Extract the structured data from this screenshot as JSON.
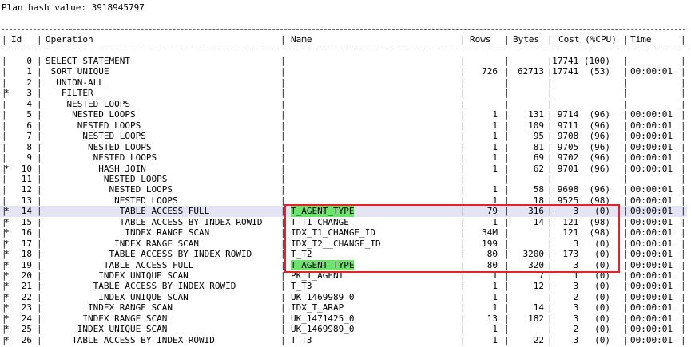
{
  "plan_hash": "Plan hash value: 3918945797",
  "columns": {
    "id": "Id",
    "operation": "Operation",
    "name": "Name",
    "rows": "Rows",
    "bytes": "Bytes",
    "cost": "Cost (%CPU)",
    "time": "Time"
  },
  "plan": [
    {
      "star": "",
      "id": "0",
      "op": "SELECT STATEMENT",
      "name": "",
      "rows": "",
      "bytes": "",
      "cost": "17741 (100)",
      "time": ""
    },
    {
      "star": "",
      "id": "1",
      "op": " SORT UNIQUE",
      "name": "",
      "rows": "726",
      "bytes": "62713",
      "cost": "17741  (53)",
      "time": "00:00:01"
    },
    {
      "star": "",
      "id": "2",
      "op": "  UNION-ALL",
      "name": "",
      "rows": "",
      "bytes": "",
      "cost": "",
      "time": ""
    },
    {
      "star": "*",
      "id": "3",
      "op": "   FILTER",
      "name": "",
      "rows": "",
      "bytes": "",
      "cost": "",
      "time": ""
    },
    {
      "star": "",
      "id": "4",
      "op": "    NESTED LOOPS",
      "name": "",
      "rows": "",
      "bytes": "",
      "cost": "",
      "time": ""
    },
    {
      "star": "",
      "id": "5",
      "op": "     NESTED LOOPS",
      "name": "",
      "rows": "1",
      "bytes": "131",
      "cost": "9714  (96)",
      "time": "00:00:01"
    },
    {
      "star": "",
      "id": "6",
      "op": "      NESTED LOOPS",
      "name": "",
      "rows": "1",
      "bytes": "109",
      "cost": "9711  (96)",
      "time": "00:00:01"
    },
    {
      "star": "",
      "id": "7",
      "op": "       NESTED LOOPS",
      "name": "",
      "rows": "1",
      "bytes": "95",
      "cost": "9708  (96)",
      "time": "00:00:01"
    },
    {
      "star": "",
      "id": "8",
      "op": "        NESTED LOOPS",
      "name": "",
      "rows": "1",
      "bytes": "81",
      "cost": "9705  (96)",
      "time": "00:00:01"
    },
    {
      "star": "",
      "id": "9",
      "op": "         NESTED LOOPS",
      "name": "",
      "rows": "1",
      "bytes": "69",
      "cost": "9702  (96)",
      "time": "00:00:01"
    },
    {
      "star": "*",
      "id": "10",
      "op": "          HASH JOIN",
      "name": "",
      "rows": "1",
      "bytes": "62",
      "cost": "9701  (96)",
      "time": "00:00:01"
    },
    {
      "star": "",
      "id": "11",
      "op": "           NESTED LOOPS",
      "name": "",
      "rows": "",
      "bytes": "",
      "cost": "",
      "time": ""
    },
    {
      "star": "",
      "id": "12",
      "op": "            NESTED LOOPS",
      "name": "",
      "rows": "1",
      "bytes": "58",
      "cost": "9698  (96)",
      "time": "00:00:01"
    },
    {
      "star": "",
      "id": "13",
      "op": "             NESTED LOOPS",
      "name": "",
      "rows": "1",
      "bytes": "18",
      "cost": "9525  (98)",
      "time": "00:00:01"
    },
    {
      "star": "*",
      "id": "14",
      "op": "              TABLE ACCESS FULL",
      "name": "T_AGENT_TYPE",
      "rows": "79",
      "bytes": "316",
      "cost": "3   (0)",
      "time": "00:00:01"
    },
    {
      "star": "*",
      "id": "15",
      "op": "              TABLE ACCESS BY INDEX ROWID",
      "name": "T_T1_CHANGE",
      "rows": "1",
      "bytes": "14",
      "cost": "121  (98)",
      "time": "00:00:01"
    },
    {
      "star": "*",
      "id": "16",
      "op": "               INDEX RANGE SCAN",
      "name": "IDX_T1_CHANGE_ID",
      "rows": "34M",
      "bytes": "",
      "cost": "121  (98)",
      "time": "00:00:01"
    },
    {
      "star": "*",
      "id": "17",
      "op": "             INDEX RANGE SCAN",
      "name": "IDX_T2__CHANGE_ID",
      "rows": "199",
      "bytes": "",
      "cost": "3   (0)",
      "time": "00:00:01"
    },
    {
      "star": "*",
      "id": "18",
      "op": "            TABLE ACCESS BY INDEX ROWID",
      "name": "T_T2",
      "rows": "80",
      "bytes": "3200",
      "cost": "173   (0)",
      "time": "00:00:01"
    },
    {
      "star": "*",
      "id": "19",
      "op": "           TABLE ACCESS FULL",
      "name": "T_AGENT_TYPE",
      "rows": "80",
      "bytes": "320",
      "cost": "3   (0)",
      "time": "00:00:01"
    },
    {
      "star": "*",
      "id": "20",
      "op": "          INDEX UNIQUE SCAN",
      "name": "PK_T_AGENT",
      "rows": "1",
      "bytes": "7",
      "cost": "1   (0)",
      "time": "00:00:01"
    },
    {
      "star": "*",
      "id": "21",
      "op": "         TABLE ACCESS BY INDEX ROWID",
      "name": "T_T3",
      "rows": "1",
      "bytes": "12",
      "cost": "3   (0)",
      "time": "00:00:01"
    },
    {
      "star": "*",
      "id": "22",
      "op": "          INDEX UNIQUE SCAN",
      "name": "UK_1469989_0",
      "rows": "1",
      "bytes": "",
      "cost": "2   (0)",
      "time": "00:00:01"
    },
    {
      "star": "*",
      "id": "23",
      "op": "        INDEX RANGE SCAN",
      "name": "IDX_T_ARAP",
      "rows": "1",
      "bytes": "14",
      "cost": "3   (0)",
      "time": "00:00:01"
    },
    {
      "star": "*",
      "id": "24",
      "op": "       INDEX RANGE SCAN",
      "name": "UK_1471425_0",
      "rows": "13",
      "bytes": "182",
      "cost": "3   (0)",
      "time": "00:00:01"
    },
    {
      "star": "*",
      "id": "25",
      "op": "      INDEX UNIQUE SCAN",
      "name": "UK_1469989_0",
      "rows": "1",
      "bytes": "",
      "cost": "2   (0)",
      "time": "00:00:01"
    },
    {
      "star": "*",
      "id": "26",
      "op": "     TABLE ACCESS BY INDEX ROWID",
      "name": "T_T3",
      "rows": "1",
      "bytes": "22",
      "cost": "3   (0)",
      "time": "00:00:01"
    }
  ],
  "highlight": {
    "selected_row_id": "14",
    "highlight_names_in_rows": [
      "14",
      "19"
    ],
    "highlight_color": "#6de36d",
    "box_color": "#e8202a"
  }
}
